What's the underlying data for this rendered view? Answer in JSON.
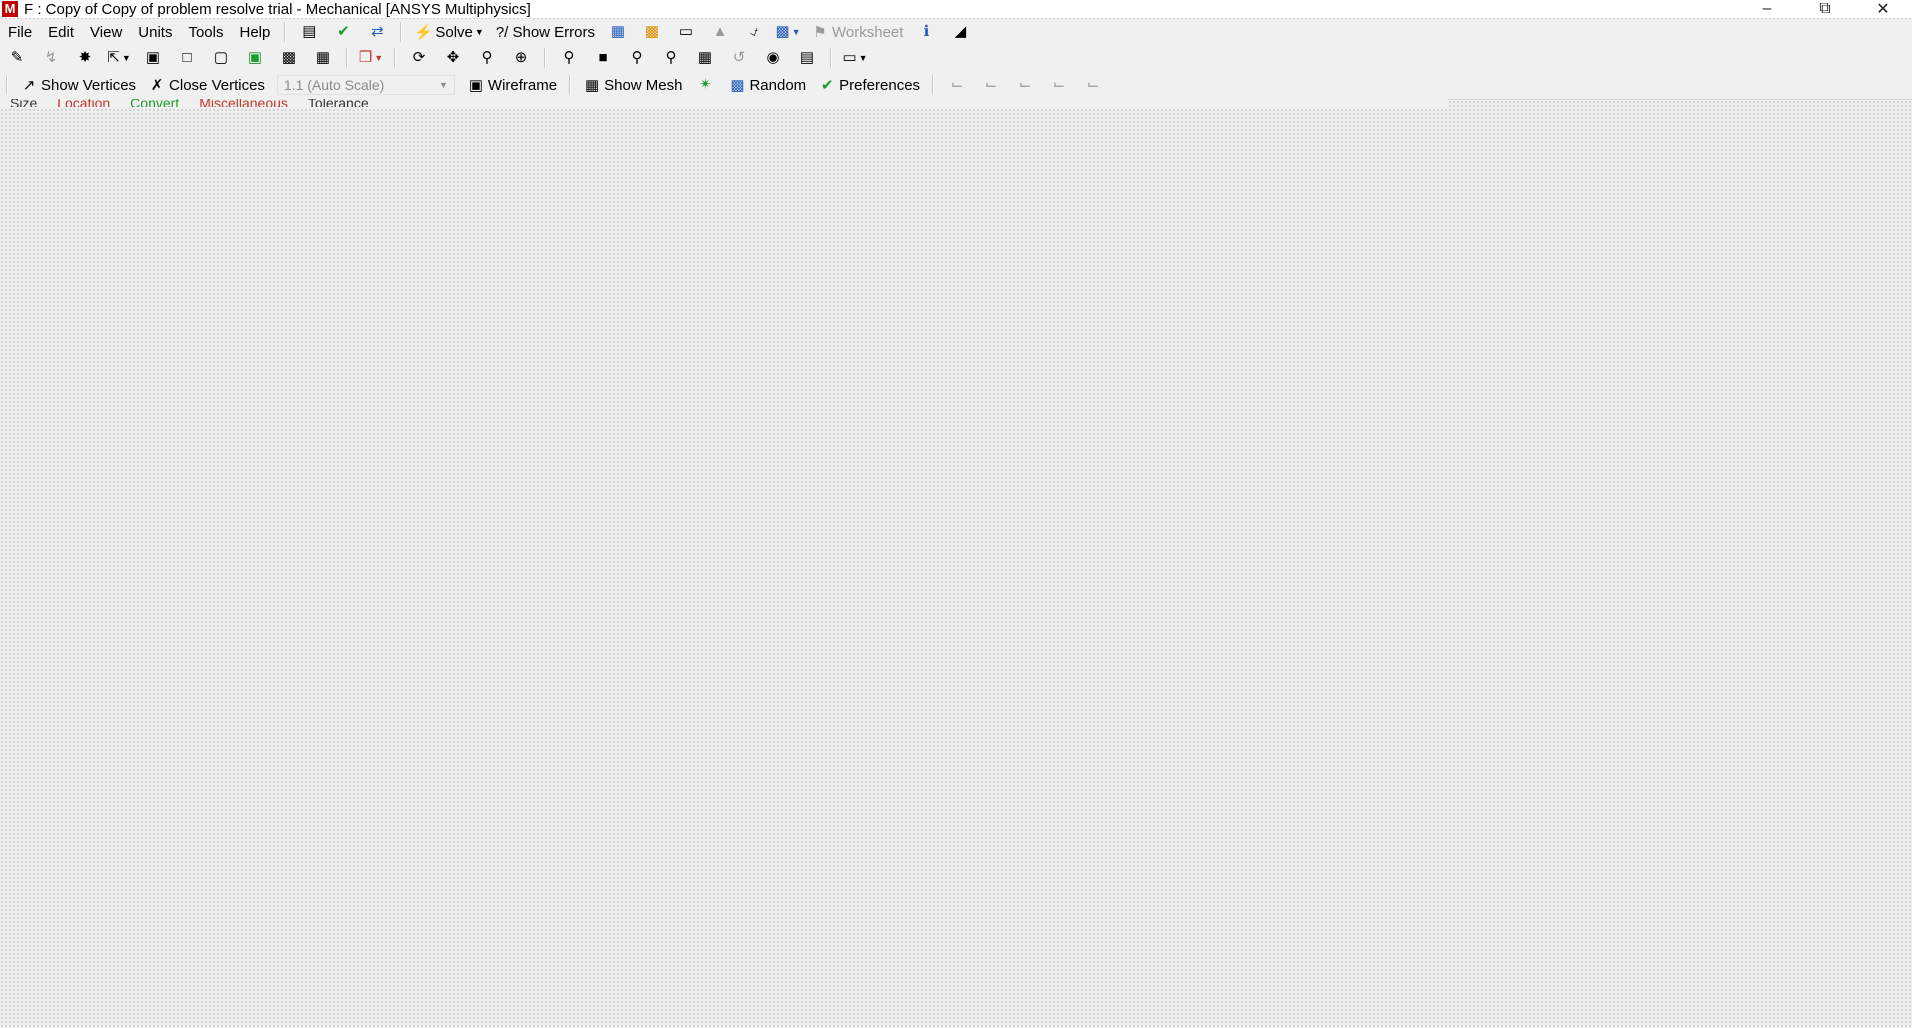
{
  "title_bar": {
    "app_icon_letter": "M",
    "title": "F : Copy of Copy of problem resolve trial - Mechanical [ANSYS Multiphysics]",
    "controls": [
      "minimize-icon",
      "restore-icon",
      "close-icon"
    ]
  },
  "menu": [
    "File",
    "Edit",
    "View",
    "Units",
    "Tools",
    "Help"
  ],
  "toolbar1": {
    "solve_label": "Solve",
    "show_errors_label": "?/ Show Errors",
    "worksheet_label": "Worksheet"
  },
  "toolbar3": {
    "show_vertices_label": "Show Vertices",
    "close_vertices_label": "Close Vertices",
    "scale_value": "1.1 (Auto Scale)",
    "wireframe_label": "Wireframe",
    "show_mesh_label": "Show Mesh",
    "random_label": "Random",
    "preferences_label": "Preferences"
  },
  "partial_row": {
    "items": [
      "Size",
      "Location",
      "Convert",
      "Miscellaneous",
      "Tolerance"
    ]
  },
  "colors": {
    "background": "#f0f0f0",
    "app_icon": "#c00000",
    "accent_green": "#1a9c2d"
  }
}
